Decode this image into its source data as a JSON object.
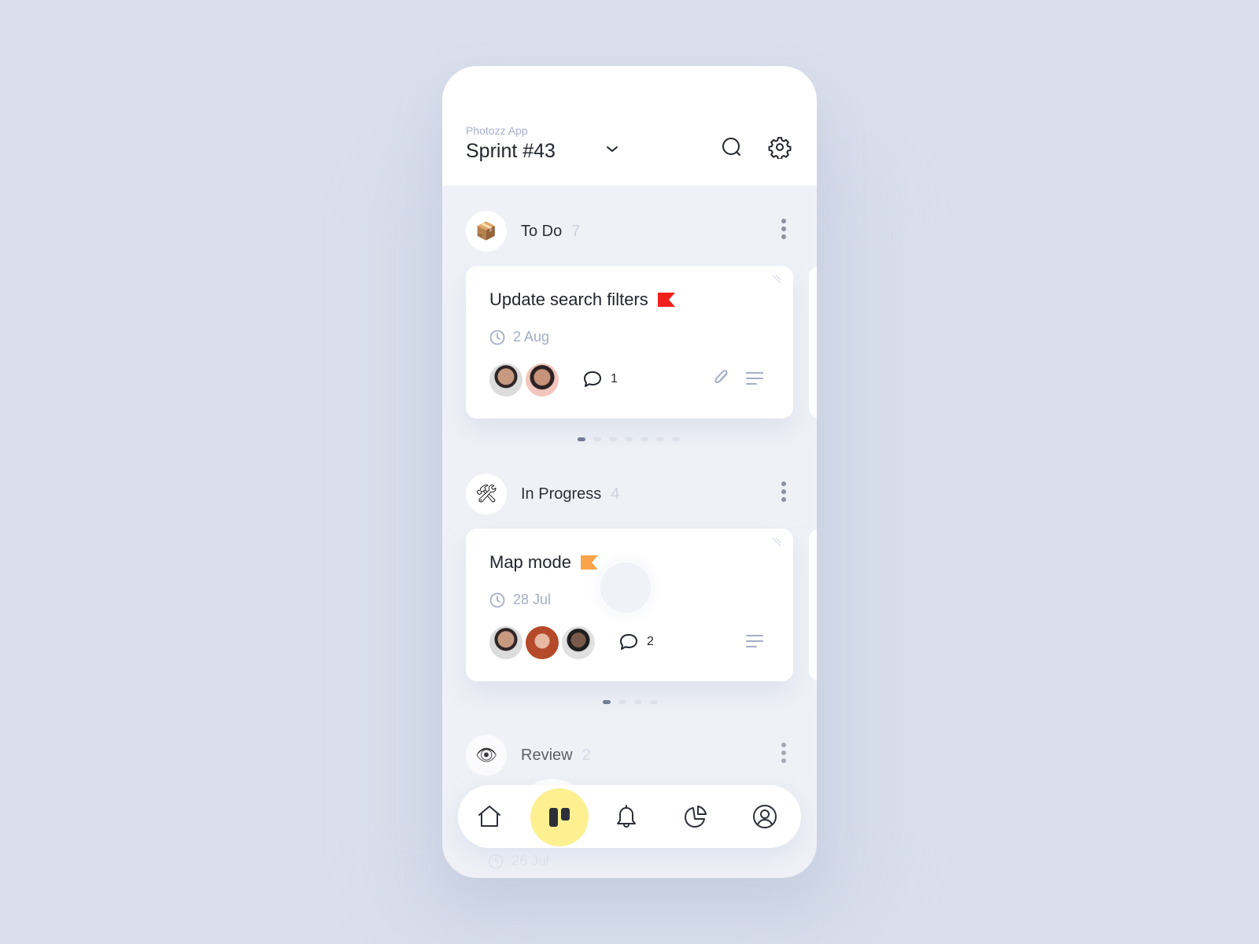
{
  "header": {
    "app_name": "Photozz App",
    "sprint_title": "Sprint #43",
    "icons": [
      "chevron-down-icon",
      "search-icon",
      "gear-icon"
    ]
  },
  "columns": [
    {
      "title": "To Do",
      "count": "7",
      "emoji": "📦",
      "card": {
        "title": "Update search filters",
        "flag_color": "#f0201c",
        "date": "2 Aug",
        "comments": "1",
        "assignees": 2,
        "has_attachment": true
      },
      "pages": 7,
      "active_page": 1
    },
    {
      "title": "In Progress",
      "count": "4",
      "emoji": "🛠",
      "card": {
        "title": "Map mode",
        "flag_color": "#f9a34a",
        "date": "28 Jul",
        "comments": "2",
        "assignees": 3,
        "has_attachment": false
      },
      "pages": 4,
      "active_page": 1
    },
    {
      "title": "Review",
      "count": "2",
      "emoji": "👁",
      "card": {
        "date": "26 Jul"
      }
    }
  ],
  "nav": {
    "items": [
      "home-icon",
      "board-icon",
      "bell-icon",
      "chart-icon",
      "profile-icon"
    ],
    "active": "board-icon",
    "active_color": "#fdf091"
  }
}
